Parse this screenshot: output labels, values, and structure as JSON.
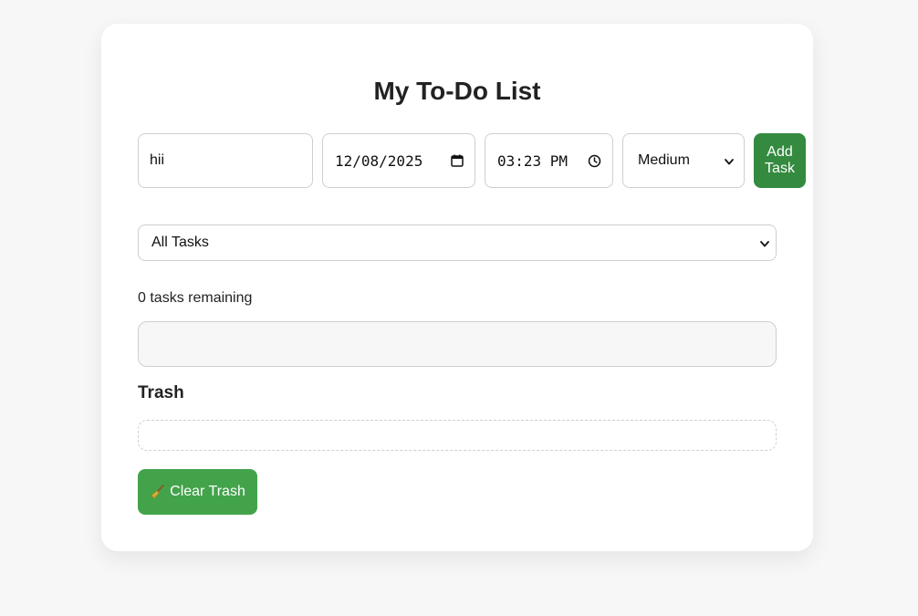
{
  "header": {
    "title": "My To-Do List"
  },
  "form": {
    "task_value": "hii",
    "date_value": "12/08/2025",
    "time_value": "03:23 PM",
    "priority_selected": "Medium",
    "add_button_label": "Add\nTask"
  },
  "filter": {
    "selected": "All Tasks"
  },
  "status": {
    "remaining_text": "0 tasks remaining"
  },
  "trash": {
    "heading": "Trash",
    "clear_button_label": "Clear Trash"
  },
  "colors": {
    "add_button": "#348a3f",
    "clear_button": "#43a34b",
    "background": "#f7f7f7"
  },
  "icons": {
    "date": "calendar-icon",
    "time": "clock-icon",
    "select": "chevron-down-icon",
    "clear": "broom-icon"
  }
}
